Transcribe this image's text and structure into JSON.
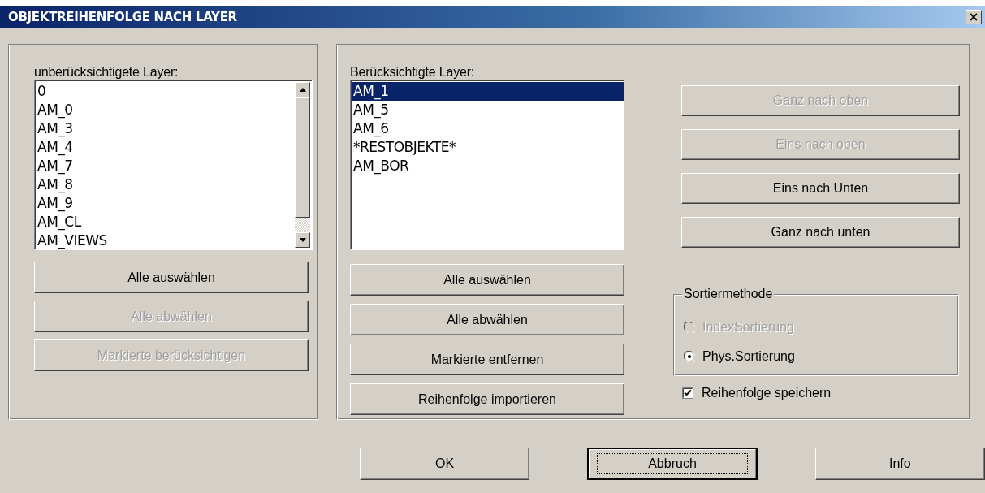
{
  "window": {
    "title": "OBJEKTREIHENFOLGE NACH LAYER",
    "close_label": "×"
  },
  "unconsidered": {
    "label": "unberücksichtigete Layer:",
    "items": [
      {
        "text": "0",
        "selected": false
      },
      {
        "text": "AM_0",
        "selected": false
      },
      {
        "text": "AM_3",
        "selected": false
      },
      {
        "text": "AM_4",
        "selected": false
      },
      {
        "text": "AM_7",
        "selected": false
      },
      {
        "text": "AM_8",
        "selected": false
      },
      {
        "text": "AM_9",
        "selected": false
      },
      {
        "text": "AM_CL",
        "selected": false
      },
      {
        "text": "AM_VIEWS",
        "selected": false
      }
    ],
    "buttons": [
      {
        "label": "Alle auswählen",
        "disabled": false
      },
      {
        "label": "Alle abwählen",
        "disabled": true
      },
      {
        "label": "Markierte berücksichtigen",
        "disabled": true
      }
    ]
  },
  "considered": {
    "label": "Berücksichtigte Layer:",
    "items": [
      {
        "text": "AM_1",
        "selected": true
      },
      {
        "text": "AM_5",
        "selected": false
      },
      {
        "text": "AM_6",
        "selected": false
      },
      {
        "text": "*RESTOBJEKTE*",
        "selected": false
      },
      {
        "text": "AM_BOR",
        "selected": false
      }
    ],
    "buttons": [
      {
        "label": "Alle auswählen",
        "disabled": false
      },
      {
        "label": "Alle abwählen",
        "disabled": false
      },
      {
        "label": "Markierte entfernen",
        "disabled": false
      },
      {
        "label": "Reihenfolge importieren",
        "disabled": false
      }
    ]
  },
  "order_buttons": [
    {
      "label": "Ganz nach oben",
      "disabled": true
    },
    {
      "label": "Eins nach oben",
      "disabled": true
    },
    {
      "label": "Eins nach Unten",
      "disabled": false
    },
    {
      "label": "Ganz nach unten",
      "disabled": false
    }
  ],
  "sort_method": {
    "title": "Sortiermethode",
    "options": [
      {
        "label": "IndexSortierung",
        "selected": false,
        "disabled": true
      },
      {
        "label": "Phys.Sortierung",
        "selected": true,
        "disabled": false
      }
    ]
  },
  "save_order": {
    "label": "Reihenfolge speichern",
    "checked": true
  },
  "footer_buttons": [
    {
      "label": "OK",
      "default": false
    },
    {
      "label": "Abbruch",
      "default": true
    },
    {
      "label": "Info",
      "default": false
    }
  ]
}
